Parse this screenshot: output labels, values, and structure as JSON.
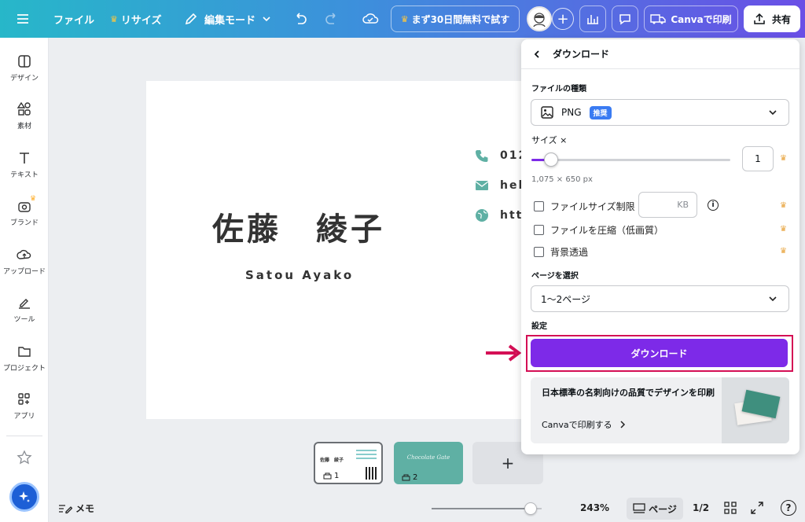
{
  "topbar": {
    "menu_icon": "hamburger-icon",
    "file": "ファイル",
    "resize": "リサイズ",
    "edit_mode": "編集モード",
    "trial": "まず30日間無料で試す",
    "print": "Canvaで印刷",
    "share": "共有"
  },
  "rail": {
    "items": [
      {
        "label": "デザイン",
        "icon": "design-icon"
      },
      {
        "label": "素材",
        "icon": "elements-icon"
      },
      {
        "label": "テキスト",
        "icon": "text-icon"
      },
      {
        "label": "ブランド",
        "icon": "brand-icon"
      },
      {
        "label": "アップロード",
        "icon": "upload-icon"
      },
      {
        "label": "ツール",
        "icon": "tools-icon"
      },
      {
        "label": "プロジェクト",
        "icon": "folder-icon"
      },
      {
        "label": "アプリ",
        "icon": "apps-icon"
      }
    ]
  },
  "card": {
    "name": "佐藤　綾子",
    "roman": "Satou Ayako",
    "phone": "012",
    "email": "hel",
    "web": "htt"
  },
  "thumbs": {
    "page1": "1",
    "page2": "2",
    "add": "+",
    "mini_name": "佐藤　綾子",
    "page2_script": "Chocolate Gate"
  },
  "bottom": {
    "notes": "メモ",
    "zoom": "243%",
    "zoom_level": 0.9,
    "pages_label": "ページ",
    "page_count": "1/2"
  },
  "panel": {
    "title": "ダウンロード",
    "file_type_label": "ファイルの種類",
    "file_type_value": "PNG",
    "recommended": "推奨",
    "size_label": "サイズ ×",
    "size_value": "1",
    "size_slider": 0.1,
    "dimensions": "1,075 × 650 px",
    "options": [
      {
        "label": "ファイルサイズ制限",
        "checked": false
      },
      {
        "label": "ファイルを圧縮（低画質）",
        "checked": false
      },
      {
        "label": "背景透過",
        "checked": false
      }
    ],
    "kb_unit": "KB",
    "page_select_label": "ページを選択",
    "page_select_value": "1〜2ページ",
    "settings_label": "設定",
    "download_button": "ダウンロード",
    "promo_title": "日本標準の名刺向けの品質でデザインを印刷",
    "promo_link": "Canvaで印刷する"
  },
  "colors": {
    "accent": "#7d2ae8",
    "highlight": "#d40f55",
    "teal": "#5fb0a4"
  }
}
